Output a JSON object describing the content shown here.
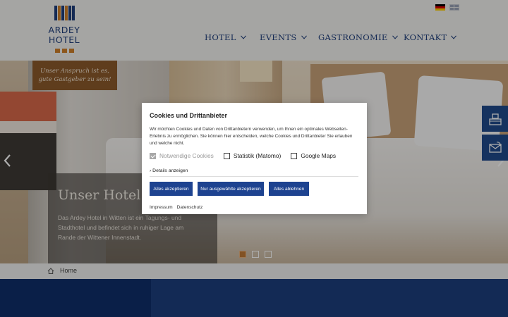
{
  "brand": {
    "line1": "ARDEY",
    "line2": "HOTEL"
  },
  "languages": [
    {
      "name": "Deutsch",
      "icon": "flag-germany-icon"
    },
    {
      "name": "English",
      "icon": "flag-uk-icon"
    }
  ],
  "nav": {
    "items": [
      {
        "label": "HOTEL"
      },
      {
        "label": "EVENTS"
      },
      {
        "label": "GASTRONOMIE"
      },
      {
        "label": "KONTAKT"
      }
    ]
  },
  "hero": {
    "tagline": "Unser Anspruch ist es, gute Gastgeber zu sein!",
    "title": "Unser Hotel",
    "text": "Das Ardey Hotel in Witten ist ein Tagungs- und Stadthotel und befindet sich in ruhiger Lage am Rande der Wittener Innenstadt.",
    "slides": 3,
    "active_slide": 1
  },
  "side_buttons": [
    {
      "icon": "reception-desk-icon"
    },
    {
      "icon": "phone-contact-icon"
    }
  ],
  "breadcrumb": {
    "home": "Home"
  },
  "cookie_modal": {
    "title": "Cookies und Drittanbieter",
    "text": "Wir möchten Cookies und Daten von Drittanbietern verwenden, um Ihnen ein optimales Webseiten-Erlebnis zu ermöglichen. Sie können hier entscheiden, welche Cookies und Drittanbieter Sie erlauben und welche nicht.",
    "options": [
      {
        "label": "Notwendige Cookies",
        "checked": true,
        "disabled": true
      },
      {
        "label": "Statistik (Matomo)",
        "checked": false,
        "disabled": false
      },
      {
        "label": "Google Maps",
        "checked": false,
        "disabled": false
      }
    ],
    "details": "Details anzeigen",
    "buttons": {
      "accept_all": "Alles akzeptieren",
      "accept_selected": "Nur ausgewählte akzeptieren",
      "reject_all": "Alles ablehnen"
    },
    "links": {
      "impressum": "Impressum",
      "datenschutz": "Datenschutz"
    }
  },
  "colors": {
    "brand_blue": "#1f3f7c",
    "accent_orange": "#d0802a",
    "button_blue": "#1e4390"
  }
}
